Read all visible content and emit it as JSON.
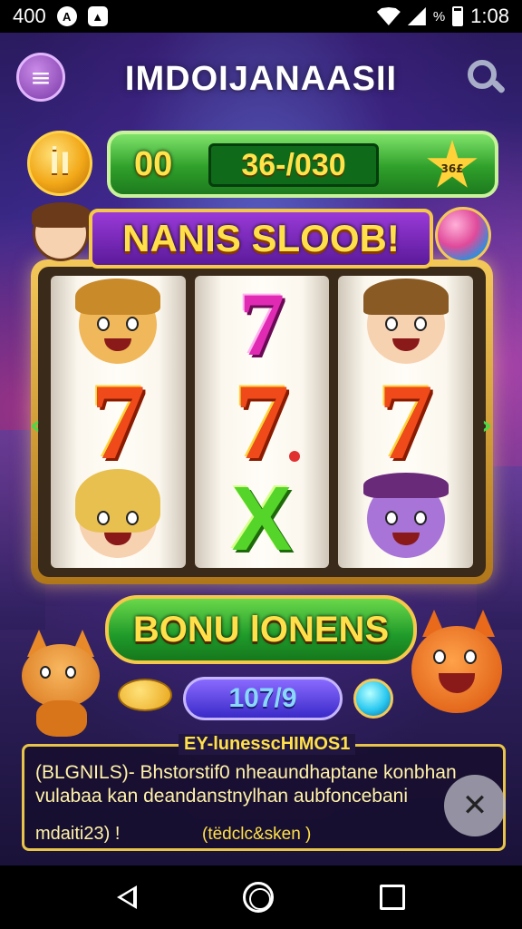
{
  "status_bar": {
    "number": "400",
    "time": "1:08",
    "battery_text": "%"
  },
  "header": {
    "title": "IMDOIJANAASII",
    "menu_icon_glyph": "≡",
    "menu_icon": "menu-icon",
    "search_icon": "search-icon"
  },
  "balance": {
    "coin_glyph": "İI",
    "amount": "00",
    "display": "36-/030",
    "badge": "36£"
  },
  "banner": {
    "title": "NANIS SLOOB!"
  },
  "reels": [
    {
      "top": "cat-face",
      "middle": "7",
      "bottom": "girl-face"
    },
    {
      "top": "7",
      "middle": "7",
      "bottom": "X"
    },
    {
      "top": "boy-face",
      "middle": "7",
      "bottom": "purple-cat-face"
    }
  ],
  "bonus_button": {
    "label": "BONU  lONENS"
  },
  "counter": {
    "value": "107/9"
  },
  "info_panel": {
    "title": "EY-lunesscHIMOS1",
    "line1": "(BLGNILS)- Bhstorstif0  nheaundhaptane konbhan",
    "line2": "vulabaa kan deandanstnylhan aubfoncebani",
    "line3": "mdaiti23)   !",
    "link": "(tëdclc&sken )"
  },
  "colors": {
    "accent_gold": "#f5c84a",
    "green_button": "#1f9a2a",
    "title_yellow": "#ffe04a",
    "background_purple": "#3a2a8a"
  }
}
